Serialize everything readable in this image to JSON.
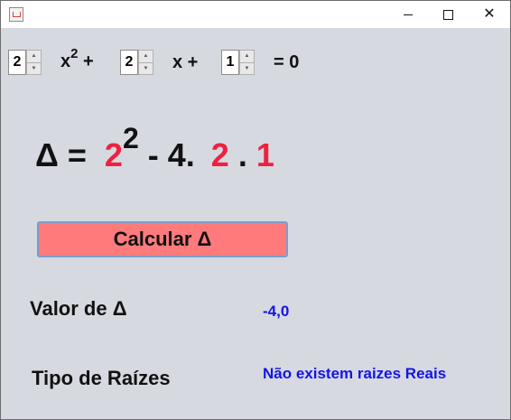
{
  "window": {
    "controls": {
      "minimize": "minimize",
      "maximize": "maximize",
      "close": "close"
    }
  },
  "equation": {
    "a": "2",
    "b": "2",
    "c": "1",
    "x2_base": "x",
    "x2_exp": "2",
    "plus1": "+",
    "x_term": "x +",
    "equals_zero": "= 0"
  },
  "formula": {
    "delta_eq": "Δ =",
    "b_value": "2",
    "b_exp": "2",
    "minus_four": "- 4.",
    "a_value": "2",
    "dot": ".",
    "c_value": "1"
  },
  "button": {
    "label": "Calcular Δ"
  },
  "results": {
    "delta_label": "Valor de Δ",
    "delta_value": "-4,0",
    "roots_label": "Tipo de Raízes",
    "roots_value": "Não existem raizes Reais"
  },
  "colors": {
    "accent_red": "#f0203e",
    "result_blue": "#1414e6",
    "button_bg": "#ff7b7b",
    "panel_bg": "#d6d9e0"
  }
}
